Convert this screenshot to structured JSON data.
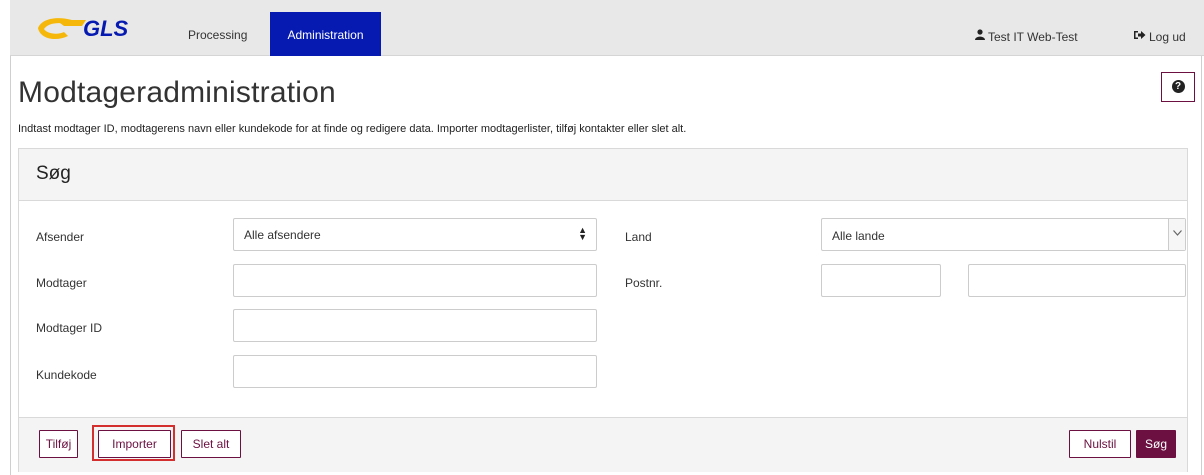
{
  "nav": {
    "logo_text": "GLS",
    "items": [
      {
        "label": "Processing"
      },
      {
        "label": "Administration"
      }
    ],
    "user_label": "Test IT Web-Test",
    "logout_label": "Log ud"
  },
  "page": {
    "title": "Modtageradministration",
    "intro": "Indtast modtager ID, modtagerens navn eller kundekode for at finde og redigere data. Importer modtagerlister, tilføj kontakter eller slet alt."
  },
  "search": {
    "heading": "Søg",
    "fields": {
      "afsender": {
        "label": "Afsender",
        "value": "Alle afsendere"
      },
      "modtager": {
        "label": "Modtager",
        "value": ""
      },
      "modtager_id": {
        "label": "Modtager ID",
        "value": ""
      },
      "kundekode": {
        "label": "Kundekode",
        "value": ""
      },
      "land": {
        "label": "Land",
        "value": "Alle lande"
      },
      "postnr": {
        "label": "Postnr.",
        "from": "",
        "to": ""
      }
    },
    "buttons": {
      "add": "Tilføj",
      "import": "Importer",
      "delete_all": "Slet alt",
      "reset": "Nulstil",
      "search": "Søg"
    }
  },
  "colors": {
    "brand_blue": "#061ab1",
    "logo_yellow": "#f5b80a",
    "accent": "#6b1040",
    "highlight": "#d32f2f"
  },
  "icons": {
    "user": "user-icon",
    "logout": "sign-out-icon",
    "help": "question-circle-icon",
    "select_arrows": "sort-icon",
    "dropdown": "chevron-down-icon"
  }
}
